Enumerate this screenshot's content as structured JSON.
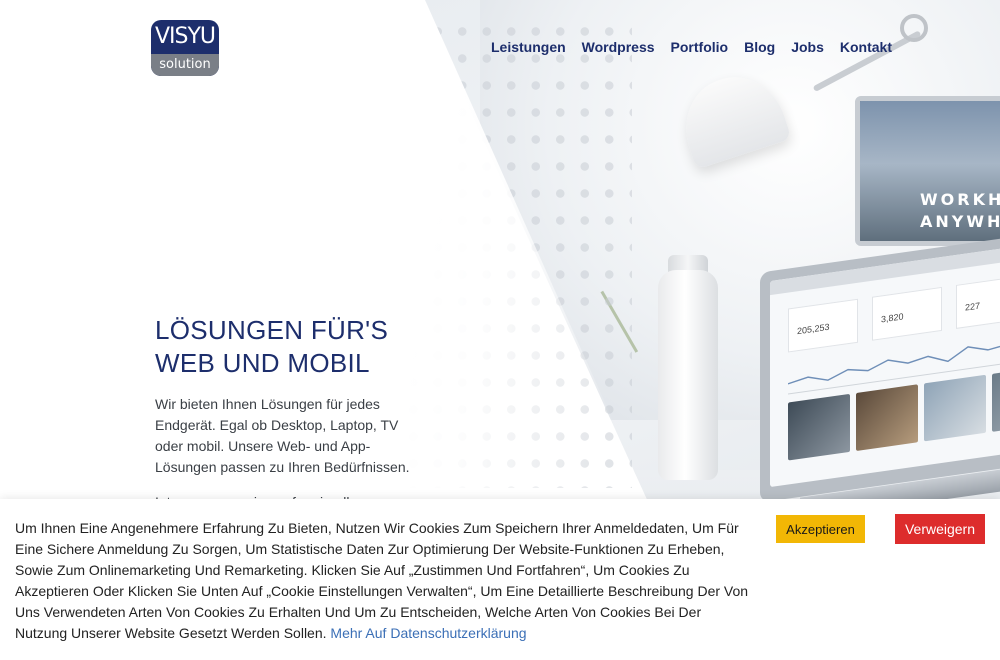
{
  "header": {
    "logo": {
      "top": "VISYU",
      "bottom": "solution"
    },
    "nav": [
      {
        "label": "Leistungen"
      },
      {
        "label": "Wordpress"
      },
      {
        "label": "Portfolio"
      },
      {
        "label": "Blog"
      },
      {
        "label": "Jobs"
      },
      {
        "label": "Kontakt"
      }
    ]
  },
  "hero": {
    "title_line1": "LÖSUNGEN FÜR'S",
    "title_line2": "WEB UND MOBIL",
    "paragraph": "Wir bieten Ihnen Lösungen für jedes Endgerät. Egal ob Desktop, Laptop, TV oder mobil. Unsere Web- und App-Lösungen passen zu Ihren Bedürfnissen.",
    "paragraph2": "Intern passen wir uns farmierell",
    "monitor_text_line1": "WORKH",
    "monitor_text_line2": "ANYWH",
    "laptop_stats": [
      "205,253",
      "3,820",
      "227"
    ]
  },
  "cookie_banner": {
    "text": "Um Ihnen Eine Angenehmere Erfahrung Zu Bieten, Nutzen Wir Cookies Zum Speichern Ihrer Anmeldedaten, Um Für Eine Sichere Anmeldung Zu Sorgen, Um Statistische Daten Zur Optimierung Der Website-Funktionen Zu Erheben, Sowie Zum Onlinemarketing Und Remarketing. Klicken Sie Auf „Zustimmen Und Fortfahren“, Um Cookies Zu Akzeptieren Oder Klicken Sie Unten Auf „Cookie Einstellungen Verwalten“, Um Eine Detaillierte Beschreibung Der Von Uns Verwendeten Arten Von Cookies Zu Erhalten Und Um Zu Entscheiden, Welche Arten Von Cookies Bei Der Nutzung Unserer Website Gesetzt Werden Sollen.",
    "link_label": "Mehr Auf Datenschutzerklärung",
    "accept_label": "Akzeptieren",
    "decline_label": "Verweigern"
  },
  "colors": {
    "brand_navy": "#1d2e6c",
    "accept_yellow": "#f2b705",
    "decline_red": "#dd2c2c",
    "link_blue": "#3b6fb6"
  }
}
